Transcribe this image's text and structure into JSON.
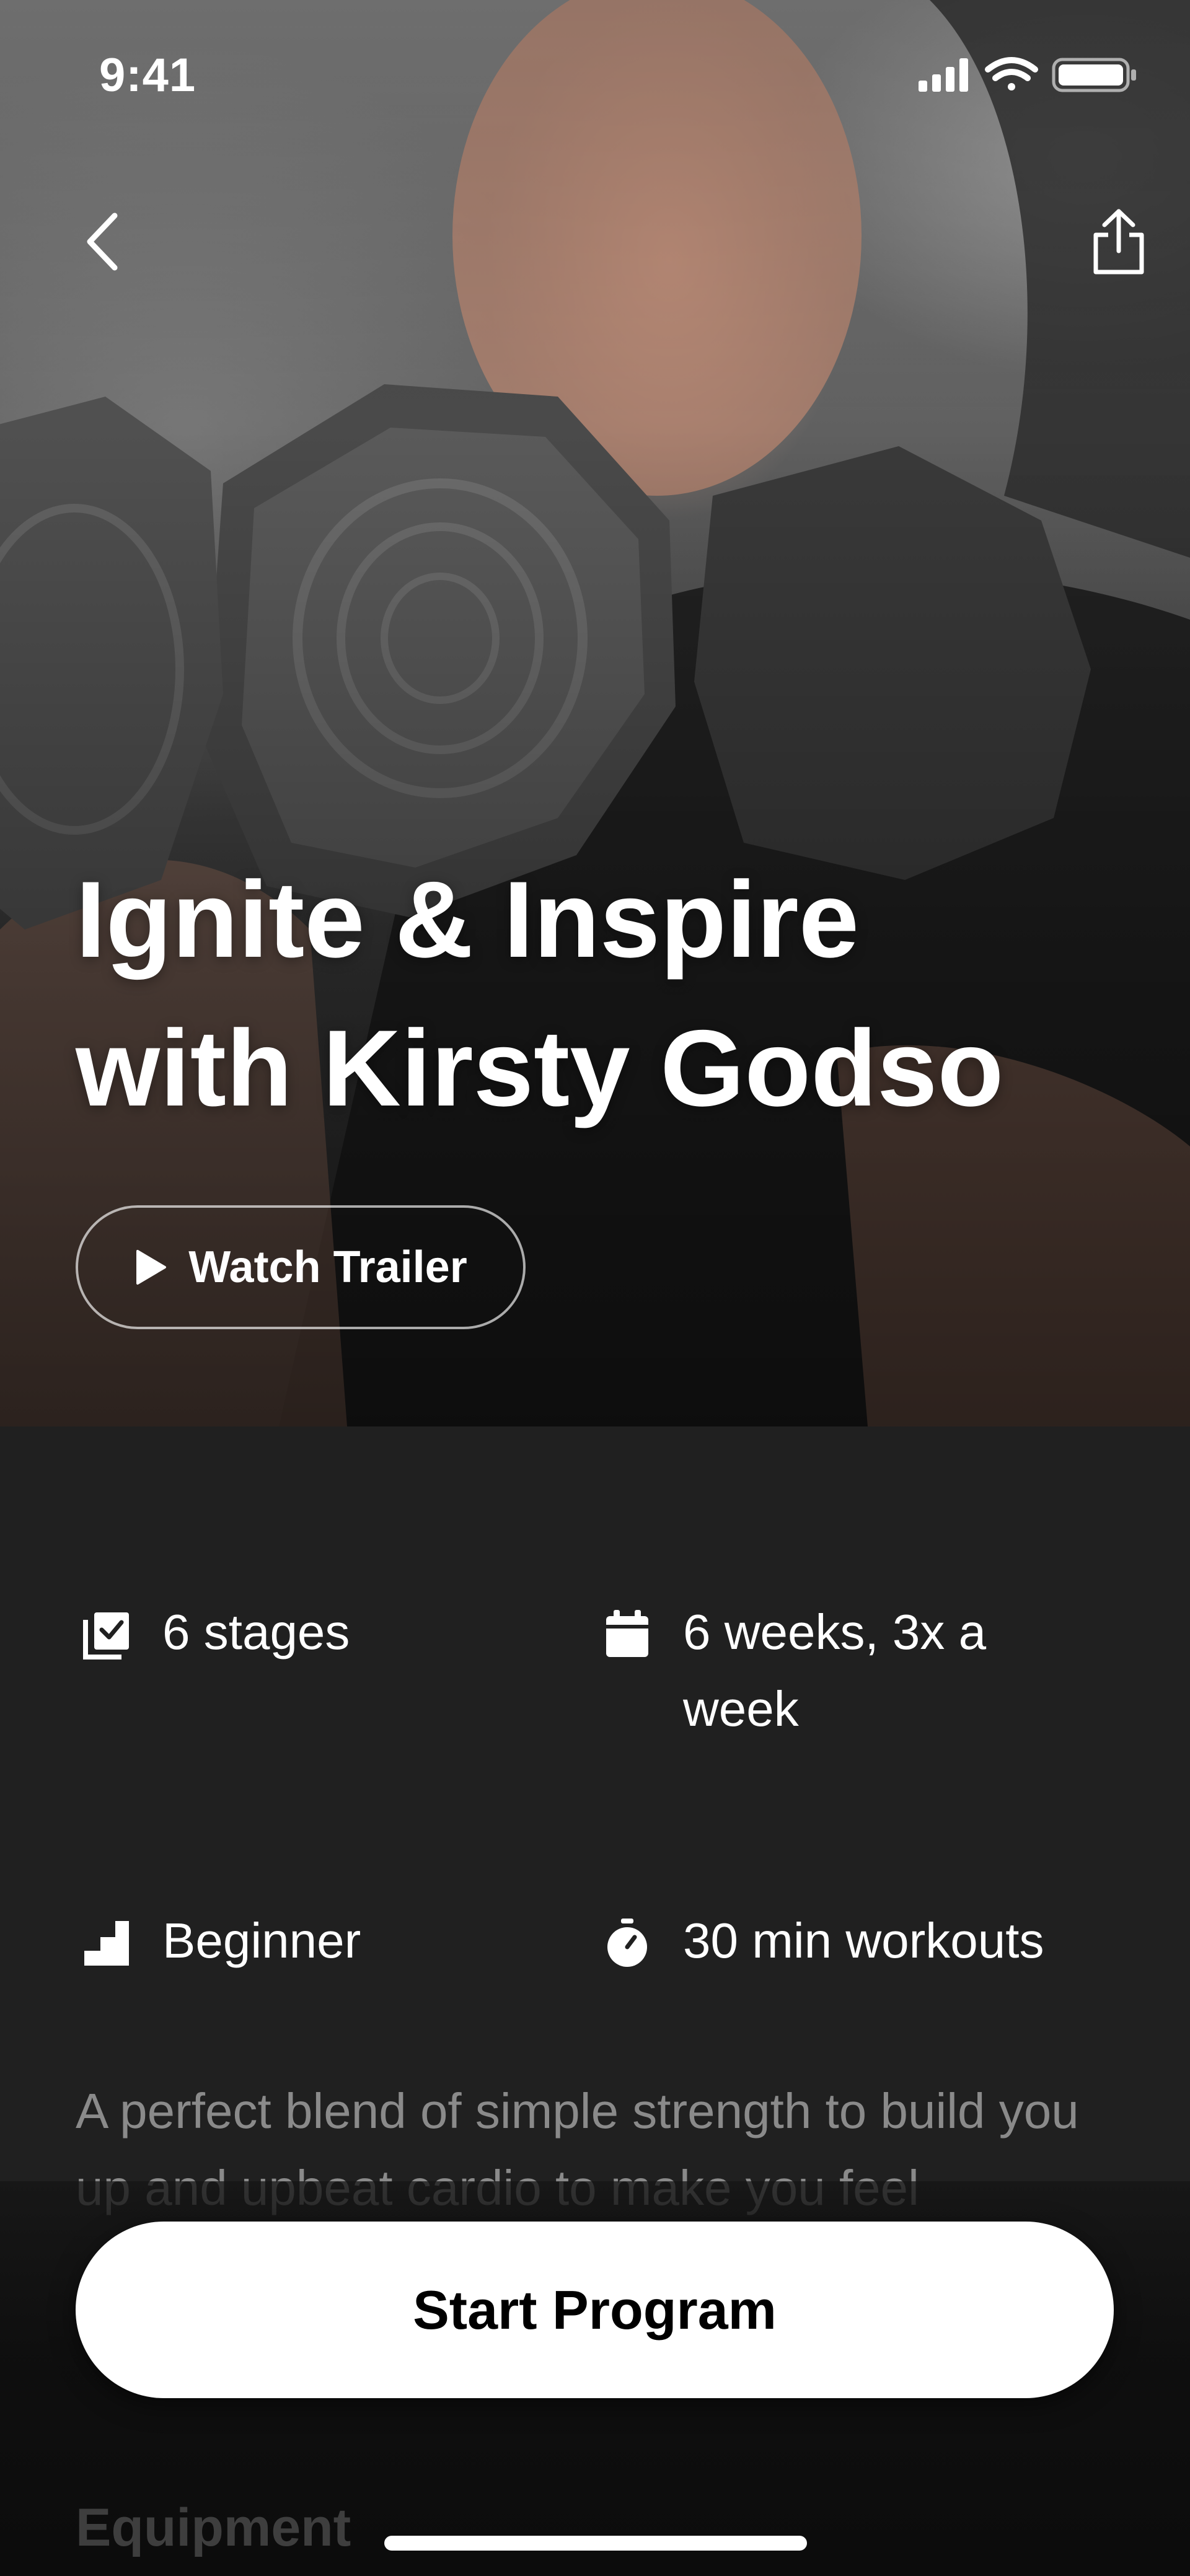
{
  "status_bar": {
    "time": "9:41",
    "icons": [
      "signal-icon",
      "wifi-icon",
      "battery-icon"
    ]
  },
  "header": {
    "back_icon": "chevron-left-icon",
    "share_icon": "share-icon"
  },
  "hero": {
    "title_line1": "Ignite & Inspire",
    "title_line2": "with Kirsty Godso",
    "trailer_label": "Watch Trailer"
  },
  "details": {
    "stages": "6 stages",
    "schedule": "6 weeks, 3x a week",
    "level": "Beginner",
    "duration": "30 min workouts"
  },
  "description": "A perfect blend of simple strength to build you up and upbeat cardio to make you feel",
  "start_label": "Start Program",
  "equipment_heading": "Equipment",
  "colors": {
    "background": "#202020",
    "button": "#ffffff",
    "muted_text": "#8a8a8a"
  }
}
